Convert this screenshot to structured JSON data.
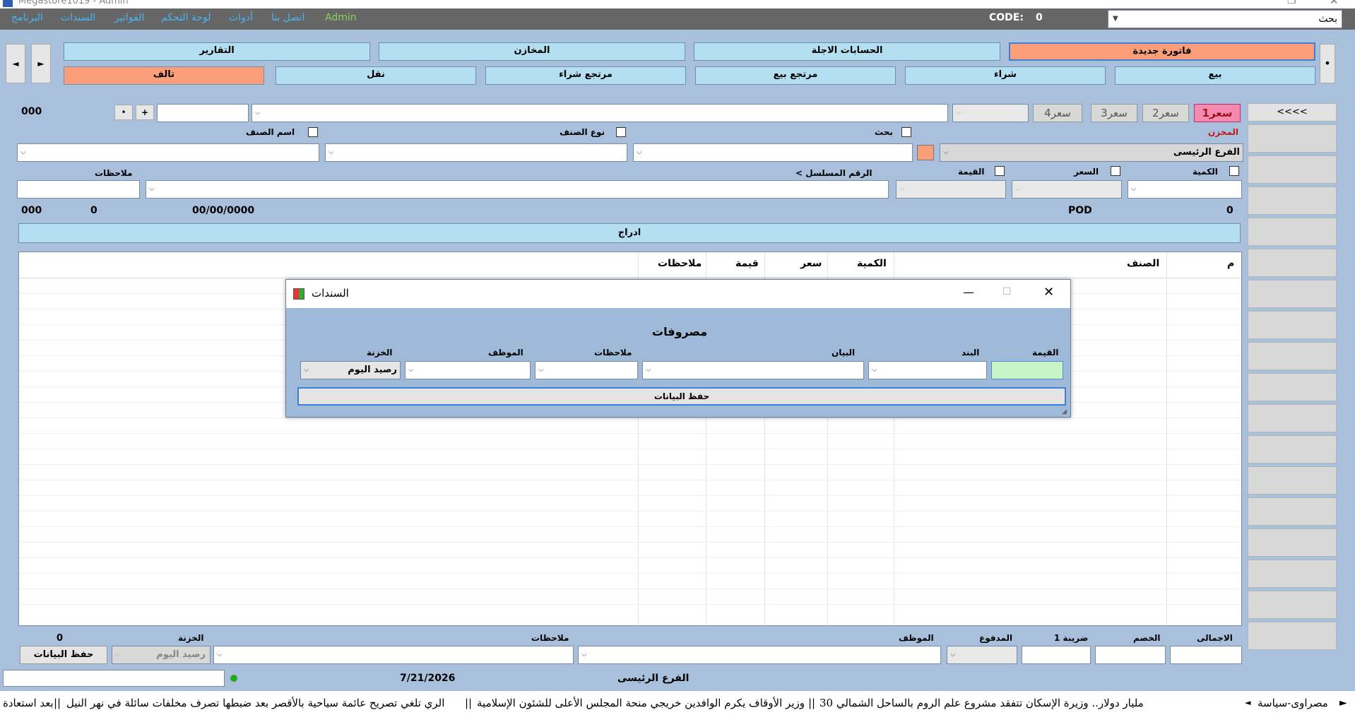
{
  "window": {
    "title": "Megastore1019 - Admin"
  },
  "menu": {
    "items": [
      "البرنامج",
      "السندات",
      "الفواتير",
      "لوحة التحكم",
      "أدوات",
      "اتصل بنا"
    ],
    "user": "Admin",
    "code_label": "CODE:",
    "code_value": "0",
    "search_value": "بحث"
  },
  "toolbar": {
    "row1": [
      "فاتورة جديدة",
      "الحسابات الاجلة",
      "المخازن",
      "التقارير"
    ],
    "row2": [
      "بيع",
      "شراء",
      "مرتجع بيع",
      "مرتجع شراء",
      "نقل",
      "تالف"
    ],
    "prev_arrow": "◄",
    "next_arrow": "►",
    "dot": "•"
  },
  "prices": {
    "tabs": [
      "سعر1",
      "سعر2",
      "سعر3",
      "سعر4"
    ],
    "nav": "<<<<"
  },
  "entry": {
    "code_value": "000",
    "plus": "+",
    "dot": "•",
    "store_label": "المخزن",
    "store_value": "الفرع الرئيسى",
    "search_label": "بحث",
    "type_label": "نوع الصنف",
    "name_label": "اسم الصنف",
    "qty_label": "الكمية",
    "price_label": "السعر",
    "value_label": "القيمة",
    "serial_label": "< الرقم المسلسل",
    "notes_label": "ملاحظات"
  },
  "summary": {
    "v1": "000",
    "v2": "0",
    "date": "00/00/0000",
    "pod": "POD",
    "v3": "0"
  },
  "insert_label": "ادراج",
  "grid": {
    "headers": [
      "م",
      "الصنف",
      "الكمية",
      "سعر",
      "قيمة",
      "ملاحظات"
    ]
  },
  "dialog": {
    "title": "السندات",
    "heading": "مصروفات",
    "labels": [
      "القيمة",
      "البند",
      "البيان",
      "ملاحظات",
      "الموظف",
      "الخزنة"
    ],
    "treasury_value": "رصيد اليوم",
    "save_label": "حفظ البيانات",
    "amount_color": "#c8f5c8"
  },
  "footer": {
    "labels": {
      "total": "الاجمالى",
      "discount": "الخصم",
      "tax": "ضريبة 1",
      "paid": "المدفوع",
      "employee": "الموظف",
      "notes": "ملاحظات",
      "treasury": "الخزنة"
    },
    "treasury_value": "رصيد اليوم",
    "amount": "0",
    "save_label": "حفظ البيانات"
  },
  "status": {
    "branch": "الفرع الرئيسى",
    "date": "7/21/2026",
    "online_color": "#22aa22"
  },
  "ticker": {
    "source": "مصراوى-سياسة",
    "headlines": [
      "30 مليار دولار.. وزيرة الإسكان تتفقد مشروع علم الروم بالساحل الشمالي",
      "وزير الأوقاف يكرم الوافدين خريجي منحة المجلس الأعلى للشئون الإسلامية",
      "الري تلغي تصريح عائمة سياحية بالأقصر بعد ضبطها تصرف مخلفات سائلة في نهر النيل",
      "بعد استعادة"
    ]
  }
}
